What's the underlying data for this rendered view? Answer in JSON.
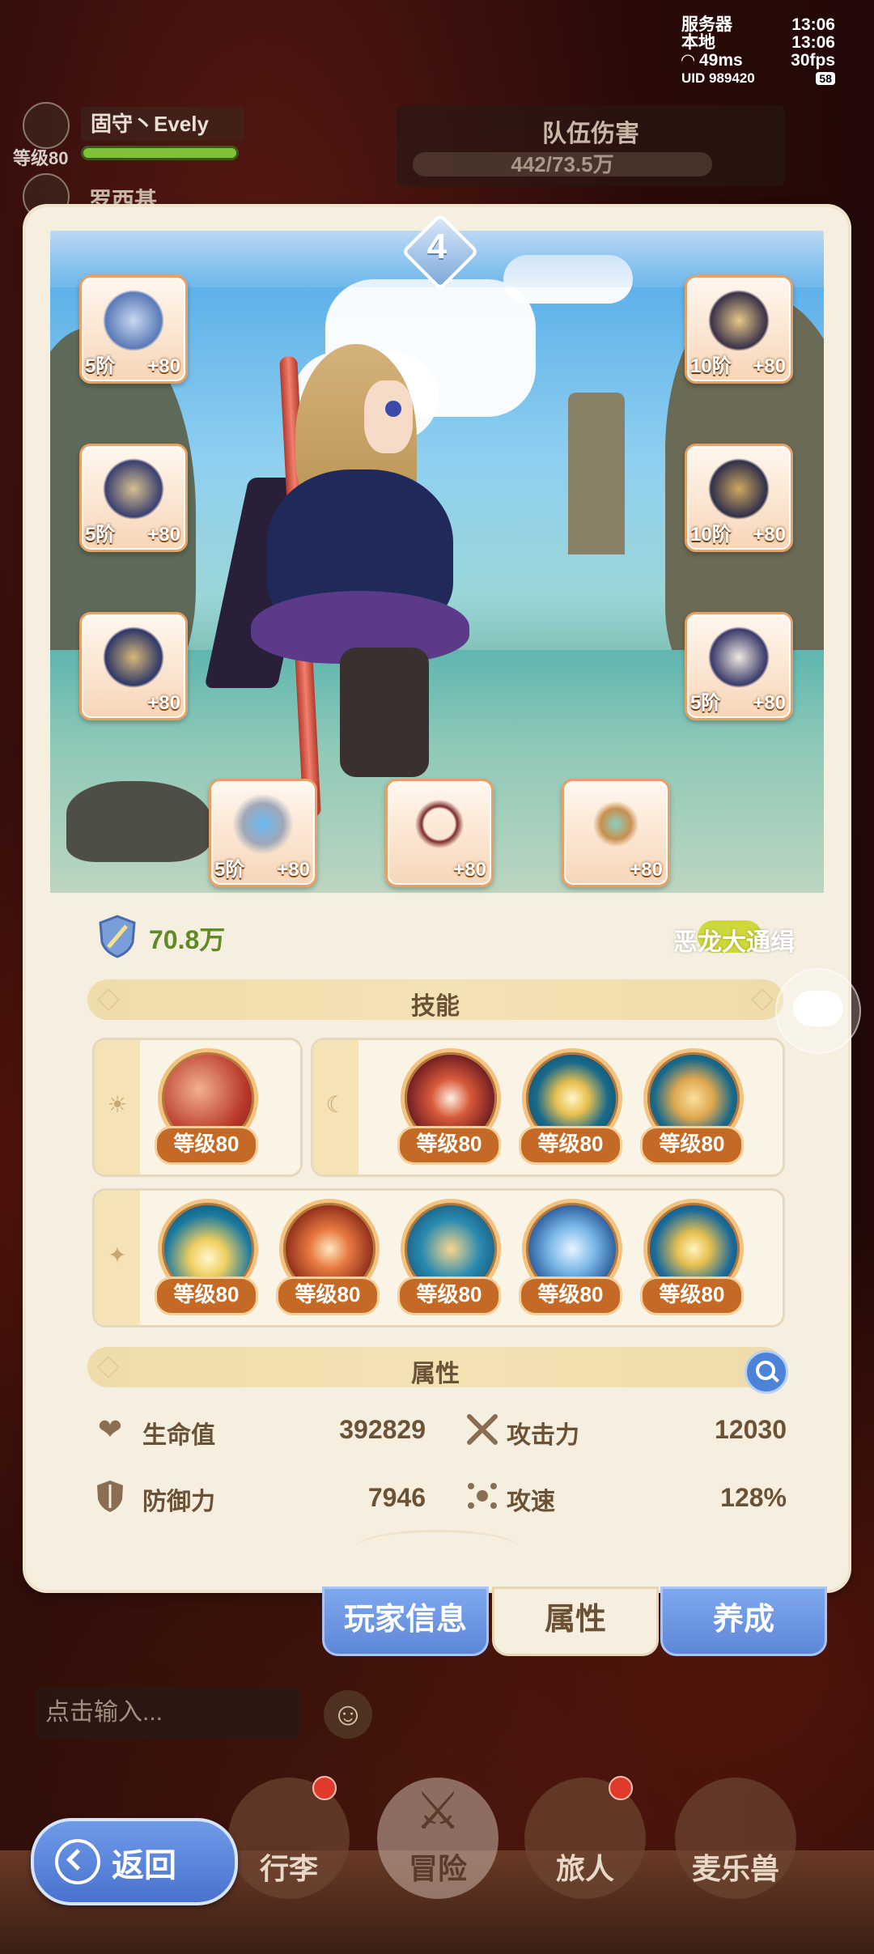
{
  "status": {
    "server_label": "服务器",
    "server_time": "13:06",
    "local_label": "本地",
    "local_time": "13:06",
    "ping": "49ms",
    "fps": "30fps",
    "uid": "UID 989420",
    "battery": "58"
  },
  "hud": {
    "player_name": "固守丶Evely",
    "player_level": "等级80",
    "player2_name": "罗西基",
    "team_damage_title": "队伍伤害",
    "team_damage_value": "442/73.5万"
  },
  "panel": {
    "rank": "4",
    "power": "70.8万",
    "guild": "恶龙大通缉",
    "equipment": [
      {
        "name": "weapon",
        "tier": "5阶",
        "level": "+80"
      },
      {
        "name": "helmet",
        "tier": "10阶",
        "level": "+80"
      },
      {
        "name": "chest-armor",
        "tier": "5阶",
        "level": "+80"
      },
      {
        "name": "shoulder",
        "tier": "10阶",
        "level": "+80"
      },
      {
        "name": "gloves",
        "tier": "",
        "level": "+80"
      },
      {
        "name": "boots",
        "tier": "5阶",
        "level": "+80"
      },
      {
        "name": "ring",
        "tier": "5阶",
        "level": "+80"
      },
      {
        "name": "necklace",
        "tier": "",
        "level": "+80"
      },
      {
        "name": "amulet",
        "tier": "",
        "level": "+80"
      }
    ],
    "skills_title": "技能",
    "skill_level": "等级80",
    "attributes_title": "属性",
    "attributes": {
      "hp_label": "生命值",
      "hp_value": "392829",
      "atk_label": "攻击力",
      "atk_value": "12030",
      "def_label": "防御力",
      "def_value": "7946",
      "spd_label": "攻速",
      "spd_value": "128%"
    }
  },
  "tabs": {
    "player_info": "玩家信息",
    "attributes": "属性",
    "develop": "养成"
  },
  "chat": {
    "placeholder": "点击输入..."
  },
  "nav": {
    "back": "返回",
    "inventory": "行李",
    "adventure": "冒险",
    "traveler": "旅人",
    "pet": "麦乐兽"
  },
  "colors": {
    "accent_blue": "#5e86d8",
    "power_green": "#5f8a26",
    "skill_level_bg": "#c46a26",
    "panel_bg": "#f6efe0"
  }
}
